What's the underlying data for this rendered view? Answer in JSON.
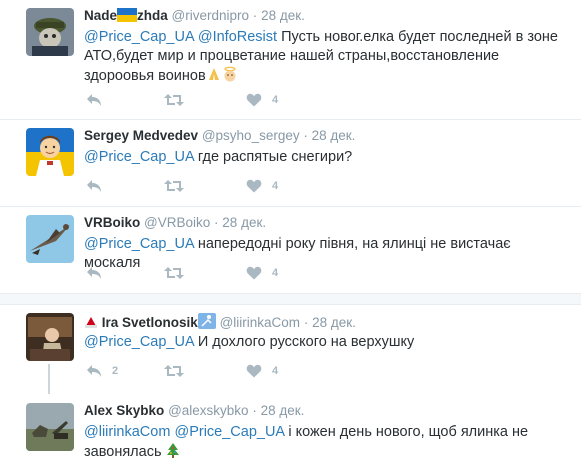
{
  "tweets": [
    {
      "name": "Nade",
      "name_suffix": "zhda",
      "handle": "@riverdnipro",
      "sep": "·",
      "time": "28 дек.",
      "mentions": [
        "@Price_Cap_UA",
        "@InfoResist"
      ],
      "text": "Пусть новог.елка будет последней в зоне АТО,будет мир и процветание нашей страны,восстановление здороовья воинов",
      "likes": "4",
      "retweets": "",
      "emoji": [
        "ukraine-flag",
        "pray",
        "angel"
      ]
    },
    {
      "name": "Sergey Medvedev",
      "handle": "@psyho_sergey",
      "sep": "·",
      "time": "28 дек.",
      "mentions": [
        "@Price_Cap_UA"
      ],
      "text": "где распятые снегири?",
      "likes": "4",
      "retweets": ""
    },
    {
      "name": "VRBoiko",
      "handle": "@VRBoiko",
      "sep": "·",
      "time": "28 дек.",
      "mentions": [
        "@Price_Cap_UA"
      ],
      "text": "напередодні року півня, на ялинці не вистачає москаля",
      "likes": "4",
      "retweets": ""
    },
    {
      "name": "Ira Svetlonosik",
      "handle": "@liirinkaCom",
      "sep": "·",
      "time": "28 дек.",
      "mentions": [
        "@Price_Cap_UA"
      ],
      "text": "И дохлого русского на верхушку",
      "replies": "2",
      "likes": "4",
      "retweets": ""
    },
    {
      "name": "Alex Skybko",
      "handle": "@alexskybko",
      "sep": "·",
      "time": "28 дек.",
      "mentions": [
        "@liirinkaCom",
        "@Price_Cap_UA"
      ],
      "text": "і кожен день нового, щоб ялинка не завонялась",
      "emoji": [
        "christmas-tree"
      ]
    }
  ],
  "colors": {
    "link": "#2b7bb9",
    "muted": "#8899a6",
    "icon": "#aab8c2",
    "divider": "#e6ecf0"
  },
  "icons": [
    "reply-icon",
    "retweet-icon",
    "like-icon"
  ]
}
